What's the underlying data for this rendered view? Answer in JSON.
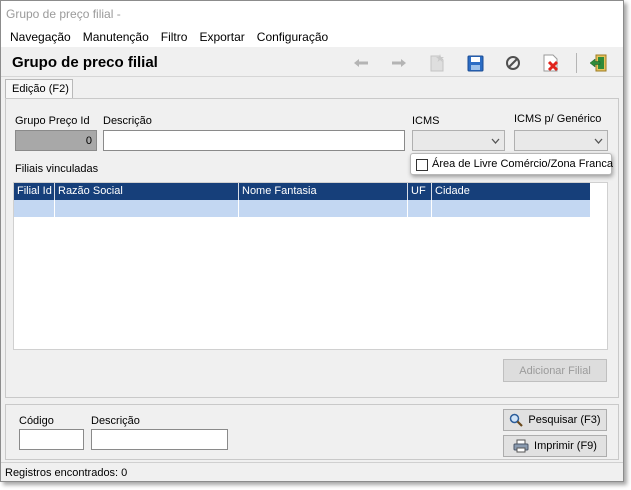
{
  "window": {
    "title": "Grupo de preço filial -"
  },
  "menu": [
    "Navegação",
    "Manutenção",
    "Filtro",
    "Exportar",
    "Configuração"
  ],
  "header": {
    "title": "Grupo de preco filial"
  },
  "toolbar": {
    "icons": [
      "back-arrow-icon",
      "forward-arrow-icon",
      "new-record-icon",
      "save-icon",
      "cancel-icon",
      "delete-icon",
      "exit-icon"
    ]
  },
  "tab": {
    "label": "Edição (F2)"
  },
  "form": {
    "grupo_id_label": "Grupo Preço Id",
    "grupo_id_value": "0",
    "descricao_label": "Descrição",
    "descricao_value": "",
    "icms_label": "ICMS",
    "icms_generico_label": "ICMS p/ Genérico",
    "area_livre_label": "Área de Livre Comércio/Zona Franca",
    "area_livre_checked": false,
    "filiais_label": "Filiais vinculadas"
  },
  "grid": {
    "columns": [
      "Filial Id",
      "Razão Social",
      "Nome Fantasia",
      "UF",
      "Cidade"
    ],
    "rows": [
      [
        "",
        "",
        "",
        "",
        ""
      ]
    ]
  },
  "buttons": {
    "adicionar_filial": "Adicionar Filial",
    "pesquisar": "Pesquisar (F3)",
    "imprimir": "Imprimir (F9)"
  },
  "search": {
    "codigo_label": "Código",
    "codigo_value": "",
    "descricao_label": "Descrição",
    "descricao_value": ""
  },
  "status": {
    "text": "Registros encontrados: 0"
  },
  "colors": {
    "grid_header": "#163f7a",
    "grid_selected_row": "#c3d7f2",
    "readonly_field": "#a8a8a8"
  }
}
